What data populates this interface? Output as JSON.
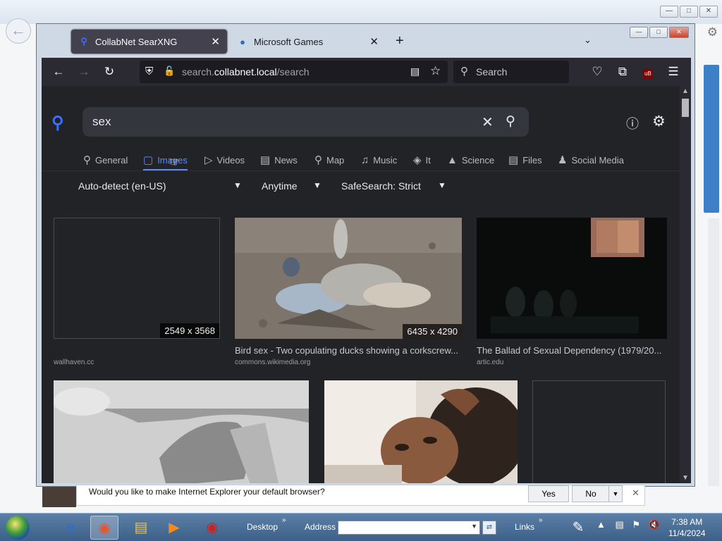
{
  "firefox": {
    "tabs": [
      {
        "title": "CollabNet SearXNG",
        "active": true
      },
      {
        "title": "Microsoft Games",
        "active": false
      }
    ],
    "url_prefix": "search.",
    "url_domain": "collabnet.local",
    "url_path": "/search",
    "searchbar_placeholder": "Search"
  },
  "searxng": {
    "query": "sex",
    "categories": [
      {
        "label": "General",
        "icon": "search-icon"
      },
      {
        "label": "Images",
        "icon": "image-icon",
        "active": true
      },
      {
        "label": "Videos",
        "icon": "play-icon"
      },
      {
        "label": "News",
        "icon": "newspaper-icon"
      },
      {
        "label": "Map",
        "icon": "map-pin-icon"
      },
      {
        "label": "Music",
        "icon": "music-icon"
      },
      {
        "label": "It",
        "icon": "layers-icon"
      },
      {
        "label": "Science",
        "icon": "graduation-cap-icon"
      },
      {
        "label": "Files",
        "icon": "drive-icon"
      },
      {
        "label": "Social Media",
        "icon": "people-icon"
      }
    ],
    "filters": {
      "language": "Auto-detect (en-US)",
      "time": "Anytime",
      "safesearch": "SafeSearch: Strict"
    },
    "results": [
      {
        "dims": "2549 x 3568",
        "title": "",
        "source": "wallhaven.cc"
      },
      {
        "dims": "6435 x 4290",
        "title": "Bird sex - Two copulating ducks showing a corkscrew...",
        "source": "commons.wikimedia.org"
      },
      {
        "dims": "",
        "title": "The Ballad of Sexual Dependency (1979/20...",
        "source": "artic.edu"
      },
      {
        "dims": "",
        "title": "",
        "source": ""
      },
      {
        "dims": "",
        "title": "",
        "source": ""
      },
      {
        "dims": "",
        "title": "",
        "source": ""
      }
    ]
  },
  "ie_bar": {
    "message": "Would you like to make Internet Explorer your default browser?",
    "yes": "Yes",
    "no": "No"
  },
  "taskbar": {
    "desktop": "Desktop",
    "address": "Address",
    "links": "Links",
    "time": "7:38 AM",
    "date": "11/4/2024"
  }
}
